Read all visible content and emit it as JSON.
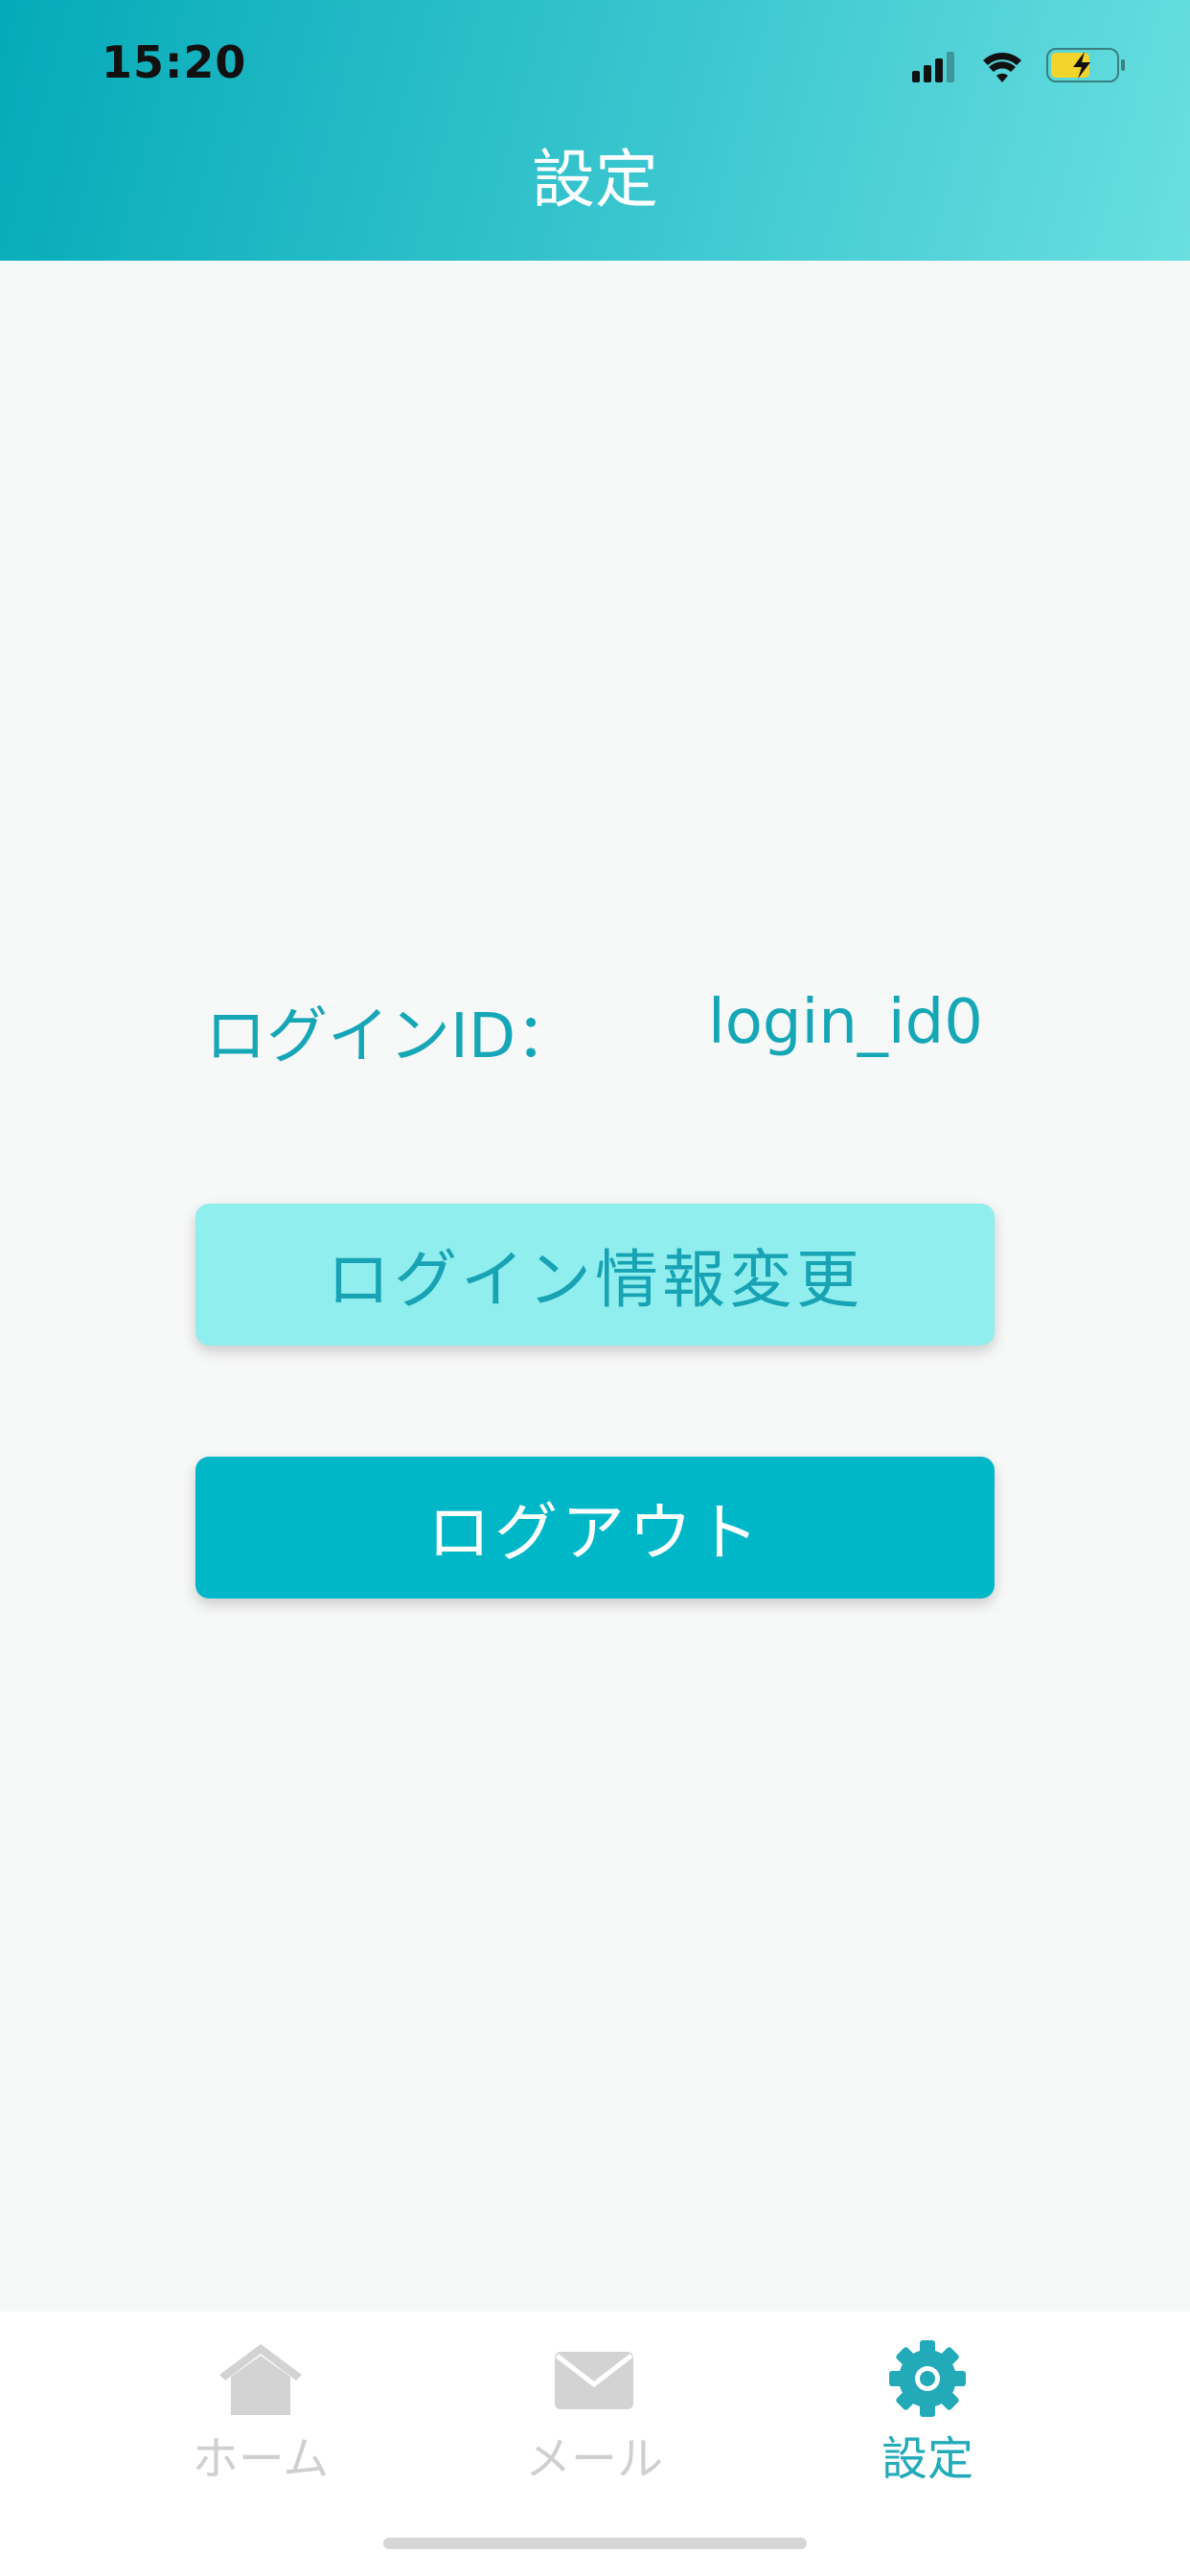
{
  "status_bar": {
    "time": "15:20",
    "icons": [
      "signal-icon",
      "wifi-icon",
      "battery-charging-icon"
    ]
  },
  "header": {
    "title": "設定"
  },
  "account": {
    "label": "ログインID：",
    "value": "login_id0"
  },
  "buttons": {
    "change_login_label": "ログイン情報変更",
    "logout_label": "ログアウト"
  },
  "tabbar": {
    "items": [
      {
        "label": "ホーム",
        "icon": "home-icon",
        "active": false
      },
      {
        "label": "メール",
        "icon": "mail-icon",
        "active": false
      },
      {
        "label": "設定",
        "icon": "gear-icon",
        "active": true
      }
    ]
  },
  "colors": {
    "accent": "#00b7c8",
    "accent_light": "#90eeee",
    "accent_text": "#16a7b7",
    "inactive_tab": "#cfcfcf"
  }
}
